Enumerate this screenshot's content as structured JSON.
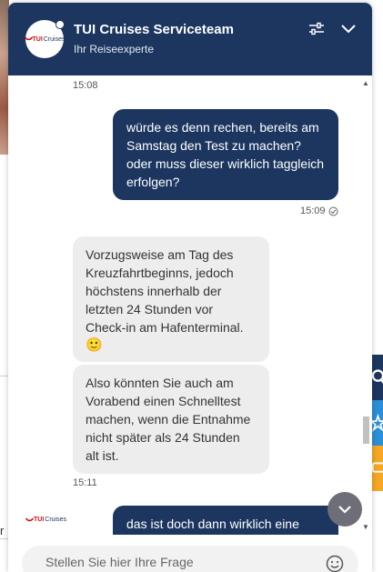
{
  "header": {
    "title": "TUI Cruises Serviceteam",
    "subtitle": "Ihr Reiseexperte",
    "logo_text": "TUI",
    "logo_sub": "Cruises",
    "icons": [
      "settings-sliders-icon",
      "chevron-down-icon"
    ]
  },
  "messages": [
    {
      "type": "timestamp",
      "text": "15:08"
    },
    {
      "type": "outgoing",
      "text": "würde es denn rechen, bereits am Samstag den Test zu machen? oder muss dieser wirklich taggleich erfolgen?",
      "time": "15:09",
      "status_icon": "read-check-icon"
    },
    {
      "type": "incoming",
      "text": "Vorzugsweise am Tag des Kreuzfahrtbeginns, jedoch höchstens innerhalb der letzten 24 Stunden vor Check-in am Hafenterminal.",
      "emoji": "🙂"
    },
    {
      "type": "incoming",
      "text": "Also könnten Sie auch am Vorabend einen Schnelltest machen, wenn die Entnahme nicht später als 24 Stunden alt ist.",
      "time": "15:11"
    },
    {
      "type": "outgoing",
      "text": "das ist doch dann wirklich eine"
    }
  ],
  "input": {
    "placeholder": "Stellen Sie hier Ihre Frage",
    "value": ""
  },
  "colors": {
    "brand": "#1c3660",
    "logo_red": "#d40e14",
    "bubble_in": "#ededed",
    "side_button_1": "#1c3660",
    "side_button_2": "#2b8fd6",
    "side_button_3": "#f5a623"
  },
  "side_icons": [
    "search-icon",
    "star-icon",
    "chat-icon"
  ]
}
